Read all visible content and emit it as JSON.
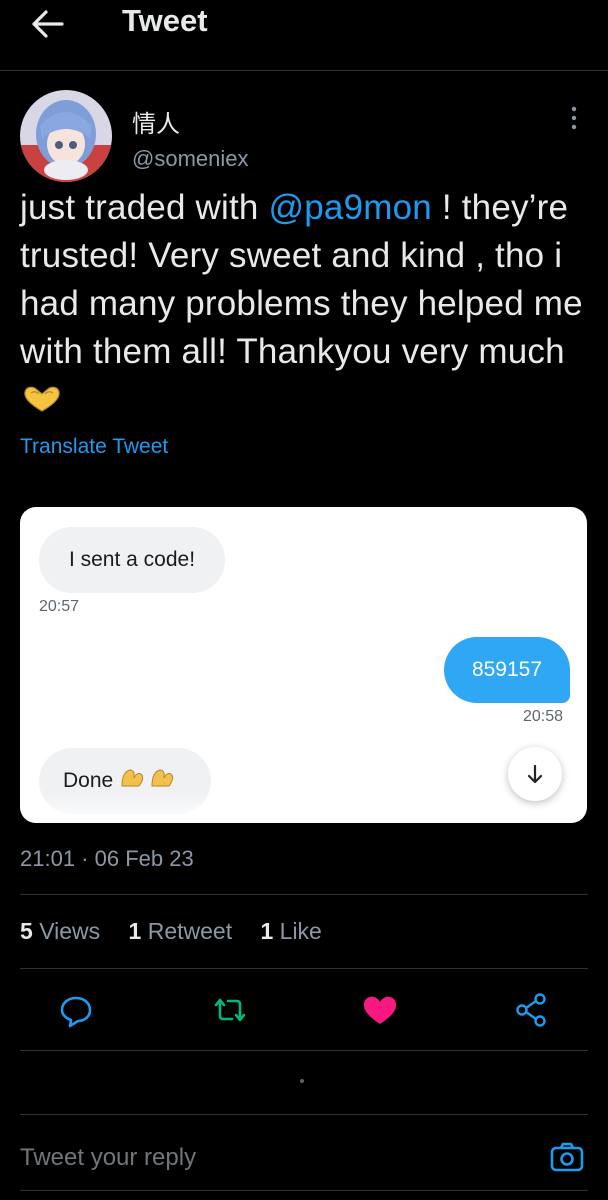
{
  "header": {
    "title": "Tweet"
  },
  "author": {
    "display_name": "情人",
    "handle": "@someniex"
  },
  "tweet": {
    "segment1": "just traded with ",
    "mention": "@pa9mon",
    "segment2": " ! they’re trusted! Very sweet and kind , tho i had many problems they helped me with them all! Thankyou very much",
    "translate_label": "Translate Tweet",
    "timestamp": "21:01 · 06 Feb 23"
  },
  "media": {
    "messages": [
      {
        "text": "I sent a code!",
        "time": "20:57",
        "side": "left"
      },
      {
        "text": "859157",
        "time": "20:58",
        "side": "right"
      },
      {
        "text": "Done",
        "side": "left"
      }
    ]
  },
  "stats": {
    "views_count": "5",
    "views_label": "Views",
    "retweets_count": "1",
    "retweets_label": "Retweet",
    "likes_count": "1",
    "likes_label": "Like"
  },
  "reply": {
    "placeholder": "Tweet your reply"
  },
  "colors": {
    "accent": "#1d9bf0",
    "retweet": "#00ba7c",
    "like": "#f91880",
    "background": "#000000"
  }
}
